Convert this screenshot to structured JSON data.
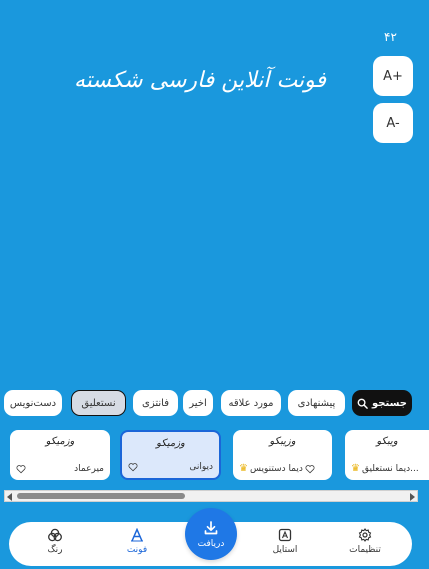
{
  "editor": {
    "font_size": "۴۲",
    "increase_label": "A+",
    "decrease_label": "A-",
    "preview_text": "فونت آنلاین فارسی شکسته"
  },
  "categories": {
    "search_label": "جستجو",
    "items": [
      "پیشنهادی",
      "مورد علاقه",
      "اخیر",
      "فانتزی",
      "نستعلیق",
      "دست‌نویس"
    ],
    "selected": "نستعلیق"
  },
  "fonts": [
    {
      "sample": "ویبکو",
      "name": "دیما نستعلیق...",
      "premium": true
    },
    {
      "sample": "وزیبکو",
      "name": "دیما دستنویس",
      "premium": true
    },
    {
      "sample": "وزمیکو",
      "name": "دیوانی",
      "premium": false,
      "selected": true
    },
    {
      "sample": "وزمیکو",
      "name": "میرعماد",
      "premium": false
    }
  ],
  "nav": {
    "settings": "تنظیمات",
    "style": "استایل",
    "download": "دریافت",
    "font": "فونت",
    "color": "رنگ"
  },
  "colors": {
    "background": "#1a98dd",
    "accent": "#1b66d8",
    "premium": "#e9b10c"
  }
}
